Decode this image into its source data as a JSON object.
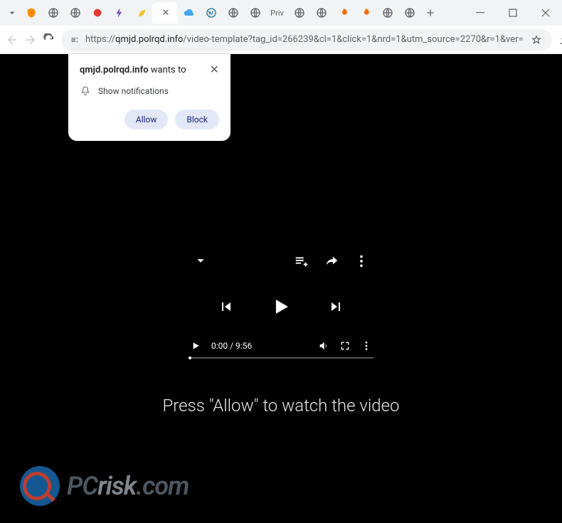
{
  "url_prefix": "https://",
  "url_host": "qmjd.polrqd.info",
  "url_path": "/video-template?tag_id=266239&cl=1&click=1&nrd=1&utm_source=2270&r=1&ver=",
  "notif": {
    "domain": "qmjd.polrqd.info",
    "wants": " wants to",
    "show": "Show notifications",
    "allow": "Allow",
    "block": "Block"
  },
  "player": {
    "time": "0:00 / 9:56"
  },
  "instruction": "Press \"Allow\" to watch the video",
  "watermark": {
    "p1": "PC",
    "p2": "risk",
    "p3": ".com"
  }
}
